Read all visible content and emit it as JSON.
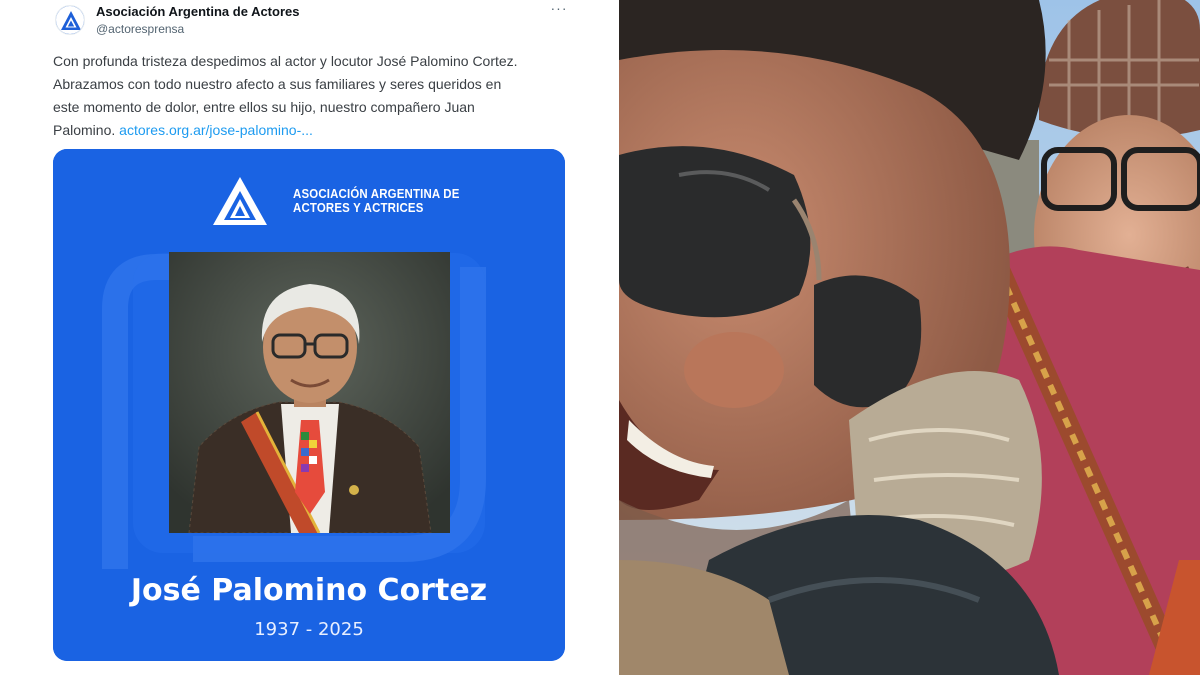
{
  "tweet": {
    "author_name": "Asociación Argentina de Actores",
    "author_handle": "@actoresprensa",
    "more_label": "···",
    "text_lines": [
      "Con profunda tristeza despedimos al actor y locutor José Palomino Cortez.",
      "Abrazamos con todo nuestro afecto a sus familiares y seres queridos en",
      "este momento de dolor, entre ellos su hijo, nuestro compañero Juan"
    ],
    "text_last_line": "Palomino.",
    "link_text": "actores.org.ar/jose-palomino-..."
  },
  "card": {
    "org_line1": "ASOCIACIÓN ARGENTINA DE",
    "org_line2": "ACTORES Y ACTRICES",
    "name": "José Palomino Cortez",
    "years": "1937 - 2025"
  },
  "colors": {
    "card_blue": "#1a63e3",
    "link_blue": "#1d9bf0",
    "text_dark": "#0f1419",
    "text_muted": "#536471"
  },
  "icons": {
    "org_logo": "triangle-logo-icon",
    "more": "more-horizontal-icon"
  }
}
